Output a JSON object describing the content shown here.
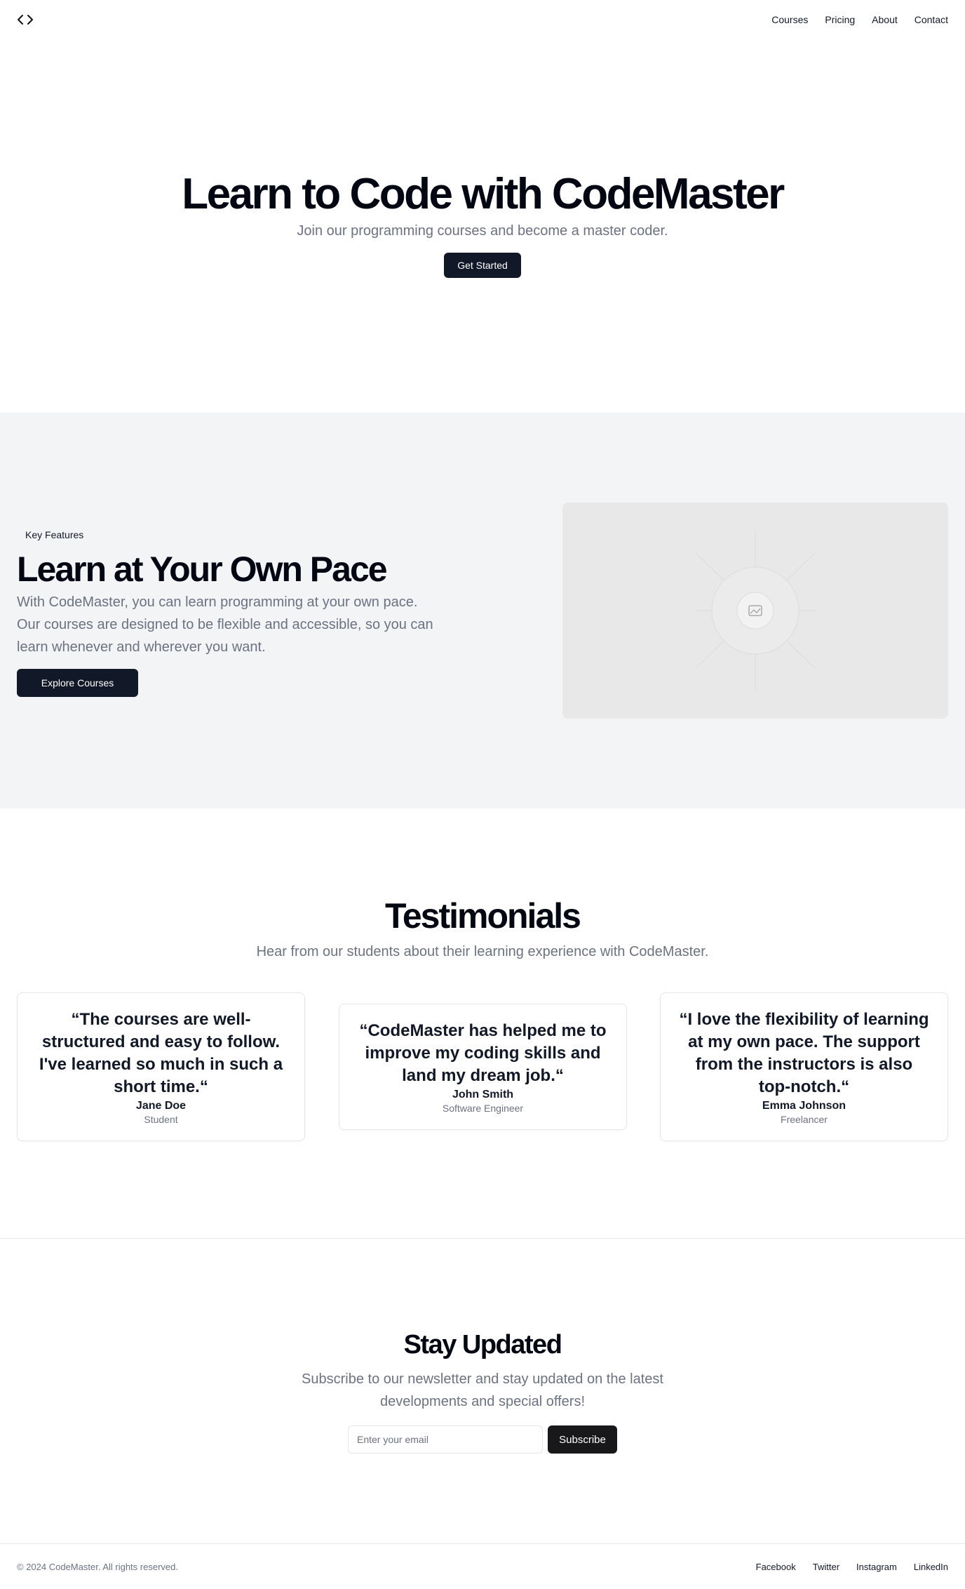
{
  "header": {
    "logo_icon": "code-icon",
    "nav": [
      "Courses",
      "Pricing",
      "About",
      "Contact"
    ]
  },
  "hero": {
    "title": "Learn to Code with CodeMaster",
    "subtitle": "Join our programming courses and become a master coder.",
    "cta": "Get Started"
  },
  "features": {
    "badge": "Key Features",
    "title": "Learn at Your Own Pace",
    "body": "With CodeMaster, you can learn programming at your own pace. Our courses are designed to be flexible and accessible, so you can learn whenever and wherever you want.",
    "cta": "Explore Courses",
    "image_icon": "image-placeholder-icon"
  },
  "testimonials": {
    "title": "Testimonials",
    "subtitle": "Hear from our students about their learning experience with CodeMaster.",
    "items": [
      {
        "quote": "“The courses are well-structured and easy to follow. I've learned so much in such a short time.“",
        "name": "Jane Doe",
        "role": "Student"
      },
      {
        "quote": "“CodeMaster has helped me to improve my coding skills and land my dream job.“",
        "name": "John Smith",
        "role": "Software Engineer"
      },
      {
        "quote": "“I love the flexibility of learning at my own pace. The support from the instructors is also top-notch.“",
        "name": "Emma Johnson",
        "role": "Freelancer"
      }
    ]
  },
  "newsletter": {
    "title": "Stay Updated",
    "body": "Subscribe to our newsletter and stay updated on the latest developments and special offers!",
    "placeholder": "Enter your email",
    "button": "Subscribe"
  },
  "footer": {
    "copyright": "© 2024 CodeMaster. All rights reserved.",
    "links": [
      "Facebook",
      "Twitter",
      "Instagram",
      "LinkedIn"
    ]
  },
  "colors": {
    "primary_button": "#111827",
    "features_bg": "#f3f4f6",
    "muted_text": "#6b7280"
  }
}
